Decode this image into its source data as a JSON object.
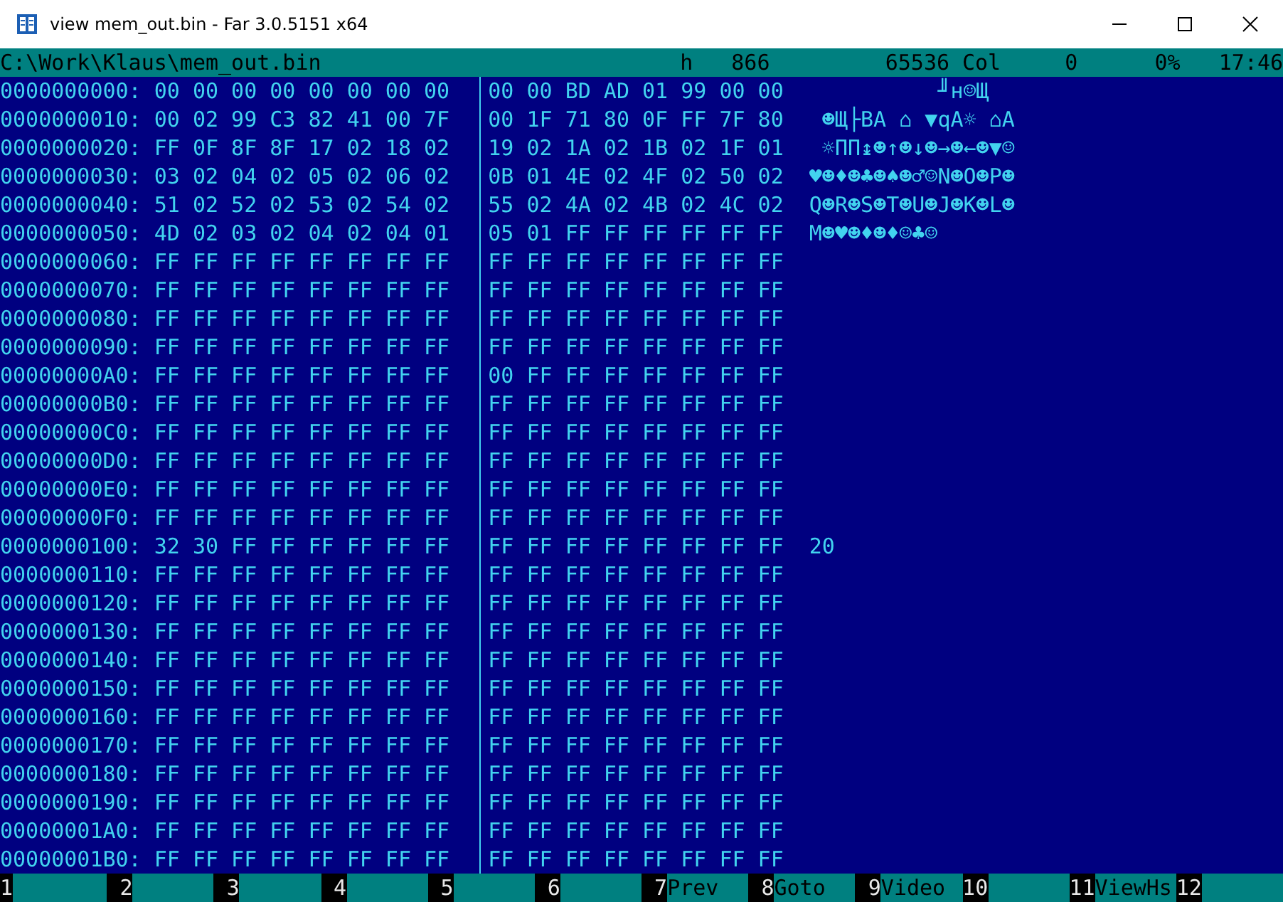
{
  "window": {
    "title": "view mem_out.bin - Far 3.0.5151 x64"
  },
  "status_bar": [
    "C:\\Work\\Klaus\\mem_out.bin",
    "h",
    "866",
    "65536",
    "Col",
    "0",
    "0%",
    "17:46"
  ],
  "rows": [
    {
      "address": "0000000000:",
      "hex_left": "00 00 00 00 00 00 00 00",
      "hex_right": "00 00 BD AD 01 99 00 00",
      "text": "          ╜н☺Щ"
    },
    {
      "address": "0000000010:",
      "hex_left": "00 02 99 C3 82 41 00 7F",
      "hex_right": "00 1F 71 80 0F FF 7F 80",
      "text": " ☻Щ├ВA ⌂ ▼qА☼ ⌂А"
    },
    {
      "address": "0000000020:",
      "hex_left": "FF 0F 8F 8F 17 02 18 02",
      "hex_right": "19 02 1A 02 1B 02 1F 01",
      "text": " ☼ПП↨☻↑☻↓☻→☻←☻▼☺"
    },
    {
      "address": "0000000030:",
      "hex_left": "03 02 04 02 05 02 06 02",
      "hex_right": "0B 01 4E 02 4F 02 50 02",
      "text": "♥☻♦☻♣☻♠☻♂☺N☻O☻P☻"
    },
    {
      "address": "0000000040:",
      "hex_left": "51 02 52 02 53 02 54 02",
      "hex_right": "55 02 4A 02 4B 02 4C 02",
      "text": "Q☻R☻S☻T☻U☻J☻K☻L☻"
    },
    {
      "address": "0000000050:",
      "hex_left": "4D 02 03 02 04 02 04 01",
      "hex_right": "05 01 FF FF FF FF FF FF",
      "text": "M☻♥☻♦☻♦☺♣☺"
    },
    {
      "address": "0000000060:",
      "hex_left": "FF FF FF FF FF FF FF FF",
      "hex_right": "FF FF FF FF FF FF FF FF"
    },
    {
      "address": "0000000070:",
      "hex_left": "FF FF FF FF FF FF FF FF",
      "hex_right": "FF FF FF FF FF FF FF FF"
    },
    {
      "address": "0000000080:",
      "hex_left": "FF FF FF FF FF FF FF FF",
      "hex_right": "FF FF FF FF FF FF FF FF"
    },
    {
      "address": "0000000090:",
      "hex_left": "FF FF FF FF FF FF FF FF",
      "hex_right": "FF FF FF FF FF FF FF FF"
    },
    {
      "address": "00000000A0:",
      "hex_left": "FF FF FF FF FF FF FF FF",
      "hex_right": "00 FF FF FF FF FF FF FF"
    },
    {
      "address": "00000000B0:",
      "hex_left": "FF FF FF FF FF FF FF FF",
      "hex_right": "FF FF FF FF FF FF FF FF"
    },
    {
      "address": "00000000C0:",
      "hex_left": "FF FF FF FF FF FF FF FF",
      "hex_right": "FF FF FF FF FF FF FF FF"
    },
    {
      "address": "00000000D0:",
      "hex_left": "FF FF FF FF FF FF FF FF",
      "hex_right": "FF FF FF FF FF FF FF FF"
    },
    {
      "address": "00000000E0:",
      "hex_left": "FF FF FF FF FF FF FF FF",
      "hex_right": "FF FF FF FF FF FF FF FF"
    },
    {
      "address": "00000000F0:",
      "hex_left": "FF FF FF FF FF FF FF FF",
      "hex_right": "FF FF FF FF FF FF FF FF"
    },
    {
      "address": "0000000100:",
      "hex_left": "32 30 FF FF FF FF FF FF",
      "hex_right": "FF FF FF FF FF FF FF FF",
      "text": "20"
    },
    {
      "address": "0000000110:",
      "hex_left": "FF FF FF FF FF FF FF FF",
      "hex_right": "FF FF FF FF FF FF FF FF"
    },
    {
      "address": "0000000120:",
      "hex_left": "FF FF FF FF FF FF FF FF",
      "hex_right": "FF FF FF FF FF FF FF FF"
    },
    {
      "address": "0000000130:",
      "hex_left": "FF FF FF FF FF FF FF FF",
      "hex_right": "FF FF FF FF FF FF FF FF"
    },
    {
      "address": "0000000140:",
      "hex_left": "FF FF FF FF FF FF FF FF",
      "hex_right": "FF FF FF FF FF FF FF FF"
    },
    {
      "address": "0000000150:",
      "hex_left": "FF FF FF FF FF FF FF FF",
      "hex_right": "FF FF FF FF FF FF FF FF"
    },
    {
      "address": "0000000160:",
      "hex_left": "FF FF FF FF FF FF FF FF",
      "hex_right": "FF FF FF FF FF FF FF FF"
    },
    {
      "address": "0000000170:",
      "hex_left": "FF FF FF FF FF FF FF FF",
      "hex_right": "FF FF FF FF FF FF FF FF"
    },
    {
      "address": "0000000180:",
      "hex_left": "FF FF FF FF FF FF FF FF",
      "hex_right": "FF FF FF FF FF FF FF FF"
    },
    {
      "address": "0000000190:",
      "hex_left": "FF FF FF FF FF FF FF FF",
      "hex_right": "FF FF FF FF FF FF FF FF"
    },
    {
      "address": "00000001A0:",
      "hex_left": "FF FF FF FF FF FF FF FF",
      "hex_right": "FF FF FF FF FF FF FF FF"
    },
    {
      "address": "00000001B0:",
      "hex_left": "FF FF FF FF FF FF FF FF",
      "hex_right": "FF FF FF FF FF FF FF FF"
    }
  ],
  "keybar": [
    {
      "number": "1"
    },
    {
      "number": "2"
    },
    {
      "number": "3"
    },
    {
      "number": "4"
    },
    {
      "number": "5"
    },
    {
      "number": "6"
    },
    {
      "number": "7",
      "label": "Prev"
    },
    {
      "number": "8",
      "label": "Goto"
    },
    {
      "number": "9",
      "label": "Video"
    },
    {
      "number": "10"
    },
    {
      "number": "11",
      "label": "ViewHs"
    },
    {
      "number": "12"
    }
  ]
}
